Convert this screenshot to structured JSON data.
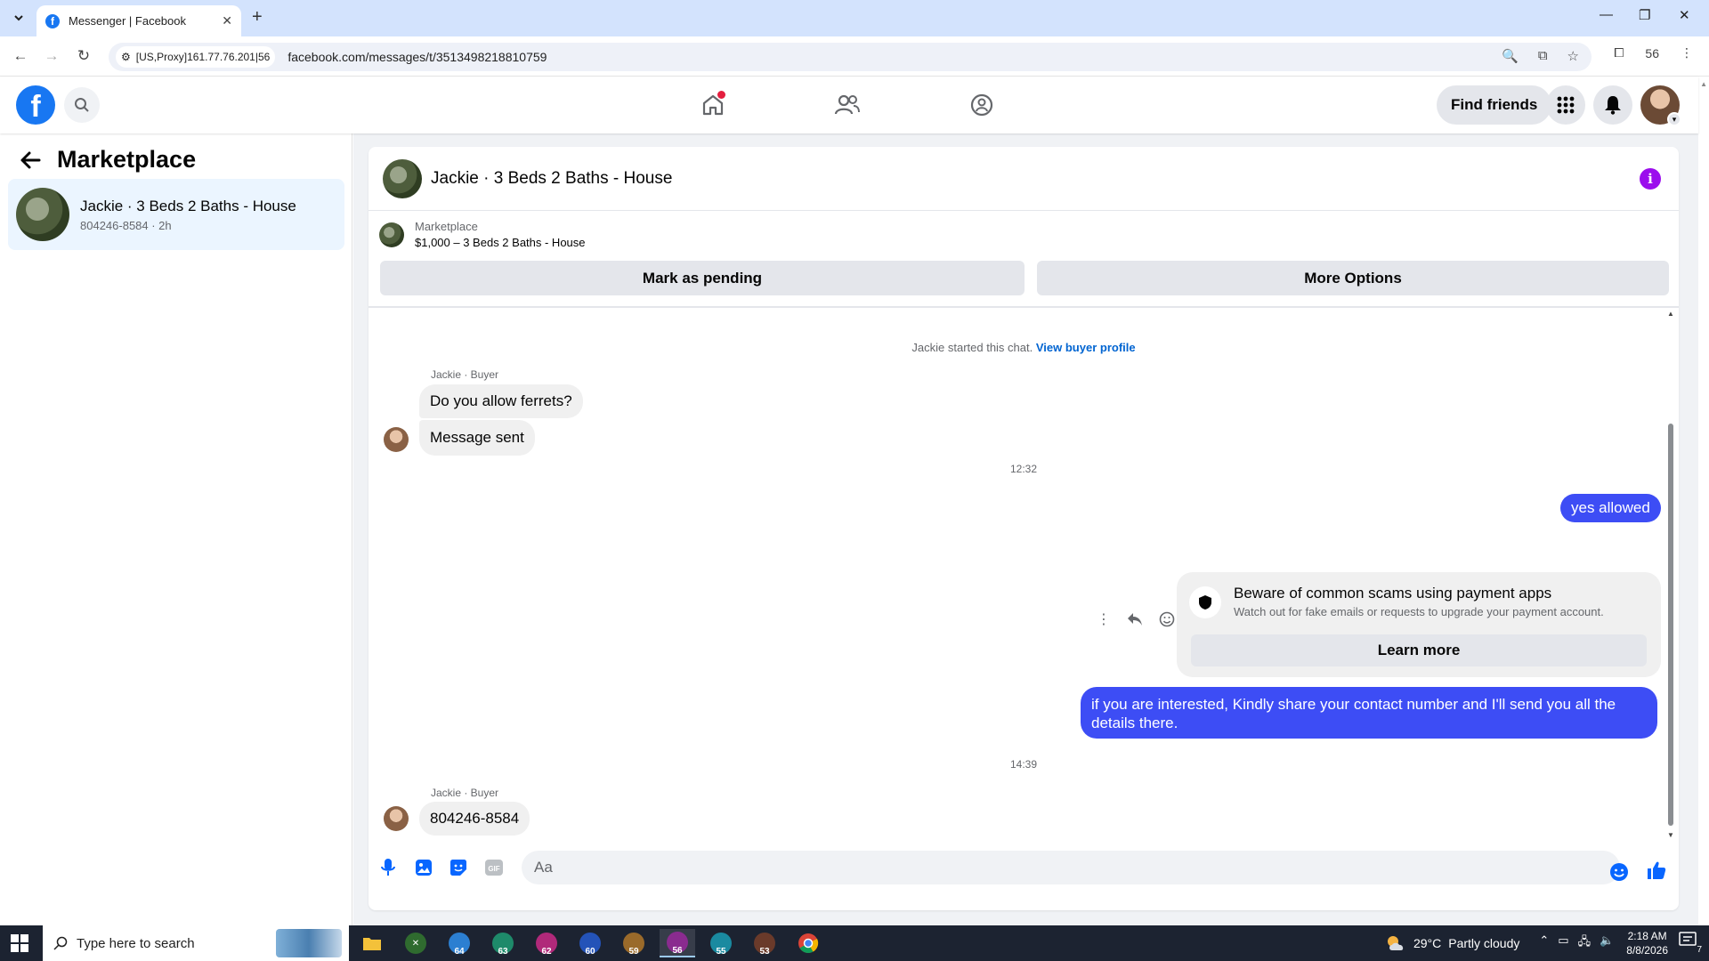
{
  "browser": {
    "tab_title": "Messenger | Facebook",
    "proxy_label": "[US,Proxy]161.77.76.201|56",
    "url": "facebook.com/messages/t/3513498218810759",
    "profile_count": "56"
  },
  "fb_header": {
    "find_friends_label": "Find friends"
  },
  "sidebar": {
    "title": "Marketplace",
    "chat_item": {
      "name": "Jackie · 3 Beds 2 Baths - House",
      "subtitle": "804246-8584 · 2h"
    }
  },
  "chat": {
    "header_title": "Jackie · 3 Beds 2 Baths - House",
    "listing_category": "Marketplace",
    "listing_title": "$1,000 – 3 Beds 2 Baths - House",
    "mark_pending_label": "Mark as pending",
    "more_options_label": "More Options",
    "started_text": "Jackie started this chat.",
    "view_profile_label": "View buyer profile",
    "messages": {
      "sender_1": "Jackie · Buyer",
      "in_1": "Do you allow ferrets?",
      "in_2": "Message sent",
      "time_1": "12:32",
      "out_1": "yes allowed",
      "scam_title": "Beware of common scams using payment apps",
      "scam_sub": "Watch out for fake emails or requests to upgrade your payment account.",
      "learn_more_label": "Learn more",
      "out_2": "if you are interested, Kindly share your contact number and I'll send you all the details there.",
      "time_2": "14:39",
      "sender_2": "Jackie · Buyer",
      "in_3": "804246-8584"
    },
    "composer_placeholder": "Aa"
  },
  "taskbar": {
    "search_placeholder": "Type here to search",
    "app_badges": [
      "64",
      "63",
      "62",
      "60",
      "59",
      "56",
      "55",
      "53"
    ],
    "weather_temp": "29°C",
    "weather_desc": "Partly cloudy",
    "time": "2:18 AM",
    "date": "8/8/2026",
    "notification_count": "7"
  },
  "colors": {
    "fb_blue": "#1877f2",
    "outgoing_bubble": "#3d4df5",
    "info_purple": "#9b0ded",
    "link_blue": "#0064d1"
  }
}
